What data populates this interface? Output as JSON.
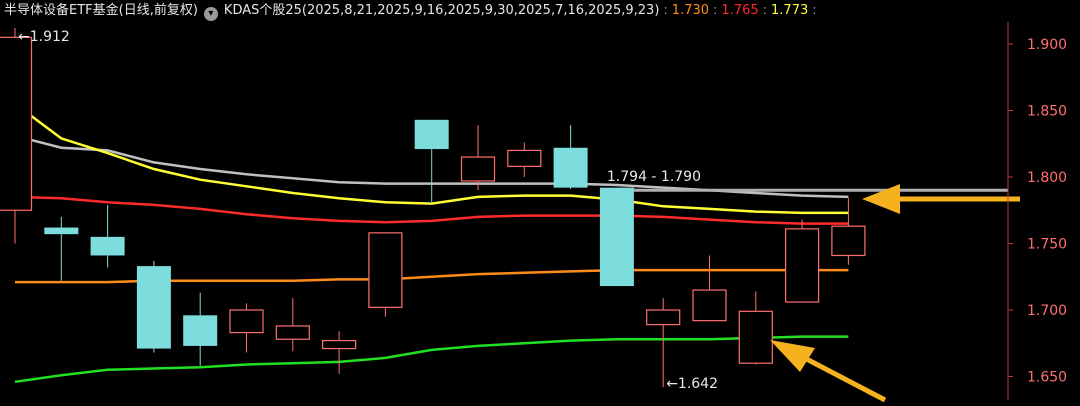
{
  "header": {
    "title": "半导体设备ETF基金(日线,前复权)",
    "toggle_icon": "chevron-down-icon",
    "indicator_name": "KDAS个股25(2025,8,21,2025,9,16,2025,9,30,2025,7,16,2025,9,23)",
    "indicator_values": [
      {
        "text": "1.730",
        "color": "#ff8c1a"
      },
      {
        "text": "1.765",
        "color": "#ff2a2a"
      },
      {
        "text": "1.773",
        "color": "#ffff33"
      }
    ]
  },
  "chart_data": {
    "type": "candlestick",
    "y_axis": {
      "min": 1.645,
      "max": 1.915,
      "ticks": [
        "1.900",
        "1.850",
        "1.800",
        "1.750",
        "1.700",
        "1.650"
      ]
    },
    "candles": [
      {
        "open": 1.775,
        "close": 1.905,
        "high": 1.912,
        "low": 1.75
      },
      {
        "open": 1.762,
        "close": 1.757,
        "high": 1.77,
        "low": 1.722
      },
      {
        "open": 1.755,
        "close": 1.741,
        "high": 1.779,
        "low": 1.732
      },
      {
        "open": 1.733,
        "close": 1.671,
        "high": 1.737,
        "low": 1.668
      },
      {
        "open": 1.696,
        "close": 1.673,
        "high": 1.713,
        "low": 1.658
      },
      {
        "open": 1.683,
        "close": 1.7,
        "high": 1.705,
        "low": 1.668
      },
      {
        "open": 1.678,
        "close": 1.688,
        "high": 1.709,
        "low": 1.669
      },
      {
        "open": 1.671,
        "close": 1.677,
        "high": 1.684,
        "low": 1.652
      },
      {
        "open": 1.702,
        "close": 1.758,
        "high": 1.758,
        "low": 1.695
      },
      {
        "open": 1.843,
        "close": 1.821,
        "high": 1.843,
        "low": 1.78
      },
      {
        "open": 1.797,
        "close": 1.815,
        "high": 1.839,
        "low": 1.79
      },
      {
        "open": 1.808,
        "close": 1.82,
        "high": 1.826,
        "low": 1.8
      },
      {
        "open": 1.822,
        "close": 1.792,
        "high": 1.839,
        "low": 1.791
      },
      {
        "open": 1.792,
        "close": 1.718,
        "high": 1.792,
        "low": 1.718
      },
      {
        "open": 1.689,
        "close": 1.7,
        "high": 1.709,
        "low": 1.642
      },
      {
        "open": 1.692,
        "close": 1.715,
        "high": 1.741,
        "low": 1.692
      },
      {
        "open": 1.66,
        "close": 1.699,
        "high": 1.714,
        "low": 1.659
      },
      {
        "open": 1.706,
        "close": 1.761,
        "high": 1.768,
        "low": 1.706
      },
      {
        "open": 1.741,
        "close": 1.763,
        "high": 1.784,
        "low": 1.734
      }
    ],
    "series": [
      {
        "color": "#c0c0c0",
        "values": [
          1.831,
          1.822,
          1.82,
          1.811,
          1.806,
          1.802,
          1.799,
          1.796,
          1.795,
          1.795,
          1.795,
          1.795,
          1.795,
          1.794,
          1.792,
          1.79,
          1.788,
          1.786,
          1.785
        ]
      },
      {
        "color": "#ffff33",
        "values": [
          1.855,
          1.829,
          1.818,
          1.806,
          1.798,
          1.793,
          1.788,
          1.784,
          1.781,
          1.78,
          1.785,
          1.786,
          1.786,
          1.783,
          1.778,
          1.776,
          1.774,
          1.773,
          1.773
        ]
      },
      {
        "color": "#ff2a2a",
        "values": [
          1.785,
          1.784,
          1.781,
          1.779,
          1.776,
          1.772,
          1.769,
          1.767,
          1.766,
          1.767,
          1.77,
          1.771,
          1.771,
          1.771,
          1.77,
          1.768,
          1.766,
          1.765,
          1.765
        ]
      },
      {
        "color": "#ff8c1a",
        "values": [
          1.721,
          1.721,
          1.721,
          1.722,
          1.722,
          1.722,
          1.722,
          1.723,
          1.723,
          1.725,
          1.727,
          1.728,
          1.729,
          1.73,
          1.73,
          1.73,
          1.73,
          1.73,
          1.73
        ]
      },
      {
        "color": "#22e022",
        "values": [
          1.646,
          1.651,
          1.655,
          1.656,
          1.657,
          1.659,
          1.66,
          1.661,
          1.664,
          1.67,
          1.673,
          1.675,
          1.677,
          1.678,
          1.678,
          1.678,
          1.679,
          1.68,
          1.68
        ]
      }
    ],
    "horizontal_line": {
      "value": 1.79,
      "color": "#b0b0b0"
    },
    "annotations": [
      {
        "text": "1.912",
        "candle": 0,
        "value": 1.912
      },
      {
        "text": "1.642",
        "candle": 14,
        "value": 1.642
      },
      {
        "text": "1.794 - 1.790",
        "candle": 13,
        "value": 1.797
      }
    ],
    "colors": {
      "up": "#ff6f6f",
      "down": "#7ddcdc",
      "axis_text": "#ff6f6f",
      "arrow": "#f5b21e",
      "background": "#000000"
    }
  }
}
